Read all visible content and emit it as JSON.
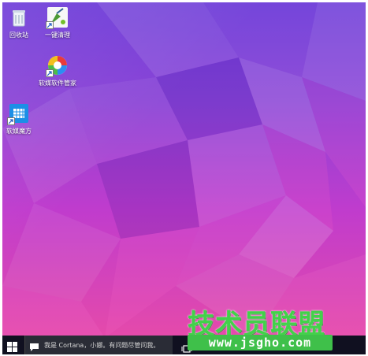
{
  "desktop": {
    "icons": [
      {
        "label": "回收站",
        "icon": "recycle-bin-icon"
      },
      {
        "label": "一键清理",
        "icon": "broom-icon"
      },
      {
        "label": "软媒软件管家",
        "icon": "software-manager-icon"
      },
      {
        "label": "软媒魔方",
        "icon": "cube-app-icon"
      }
    ]
  },
  "taskbar": {
    "start_icon": "windows-logo-icon",
    "search_placeholder": "我是 Cortana，小娜。有问题尽管问我。",
    "task_view_icon": "task-view-icon"
  },
  "watermark": {
    "title": "技术员联盟",
    "url": "www.jsgho.com"
  },
  "colors": {
    "wallpaper_top": "#6c3ad8",
    "wallpaper_bottom": "#e54aaa",
    "taskbar": "#101020",
    "watermark_green": "#42d14a"
  }
}
